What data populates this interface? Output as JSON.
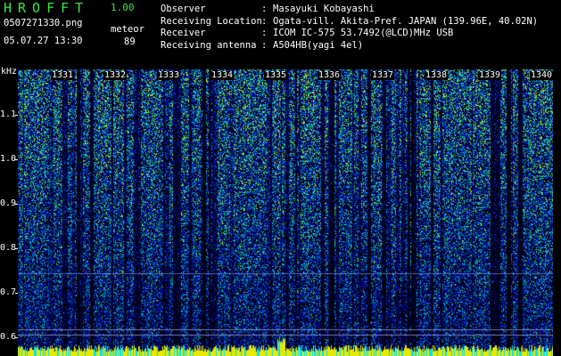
{
  "app": {
    "title": "HROFFT",
    "version": "1.00",
    "filename": "0507271330.png",
    "datetime": "05.07.27 13:30",
    "mode": "meteor",
    "count": "89"
  },
  "info": [
    {
      "key": "Observer",
      "value": "Masayuki Kobayashi"
    },
    {
      "key": "Receiving Location",
      "value": "Ogata-vill. Akita-Pref. JAPAN (139.96E, 40.02N)"
    },
    {
      "key": "Receiver",
      "value": "ICOM IC-575 53.7492(@LCD)MHz USB"
    },
    {
      "key": "Receiving antenna",
      "value": "A504HB(yagi 4el)"
    }
  ],
  "axis": {
    "y_unit": "kHz",
    "y_ticks": [
      "1.1",
      "1.0",
      "0.9",
      "0.8",
      "0.7",
      "0.6"
    ],
    "x_ticks": [
      "1331",
      "1332",
      "1333",
      "1334",
      "1335",
      "1336",
      "1337",
      "1338",
      "1339",
      "1340"
    ]
  },
  "colors": {
    "title_green": "#3ce63c",
    "text": "#ffffff",
    "background": "#000000"
  }
}
